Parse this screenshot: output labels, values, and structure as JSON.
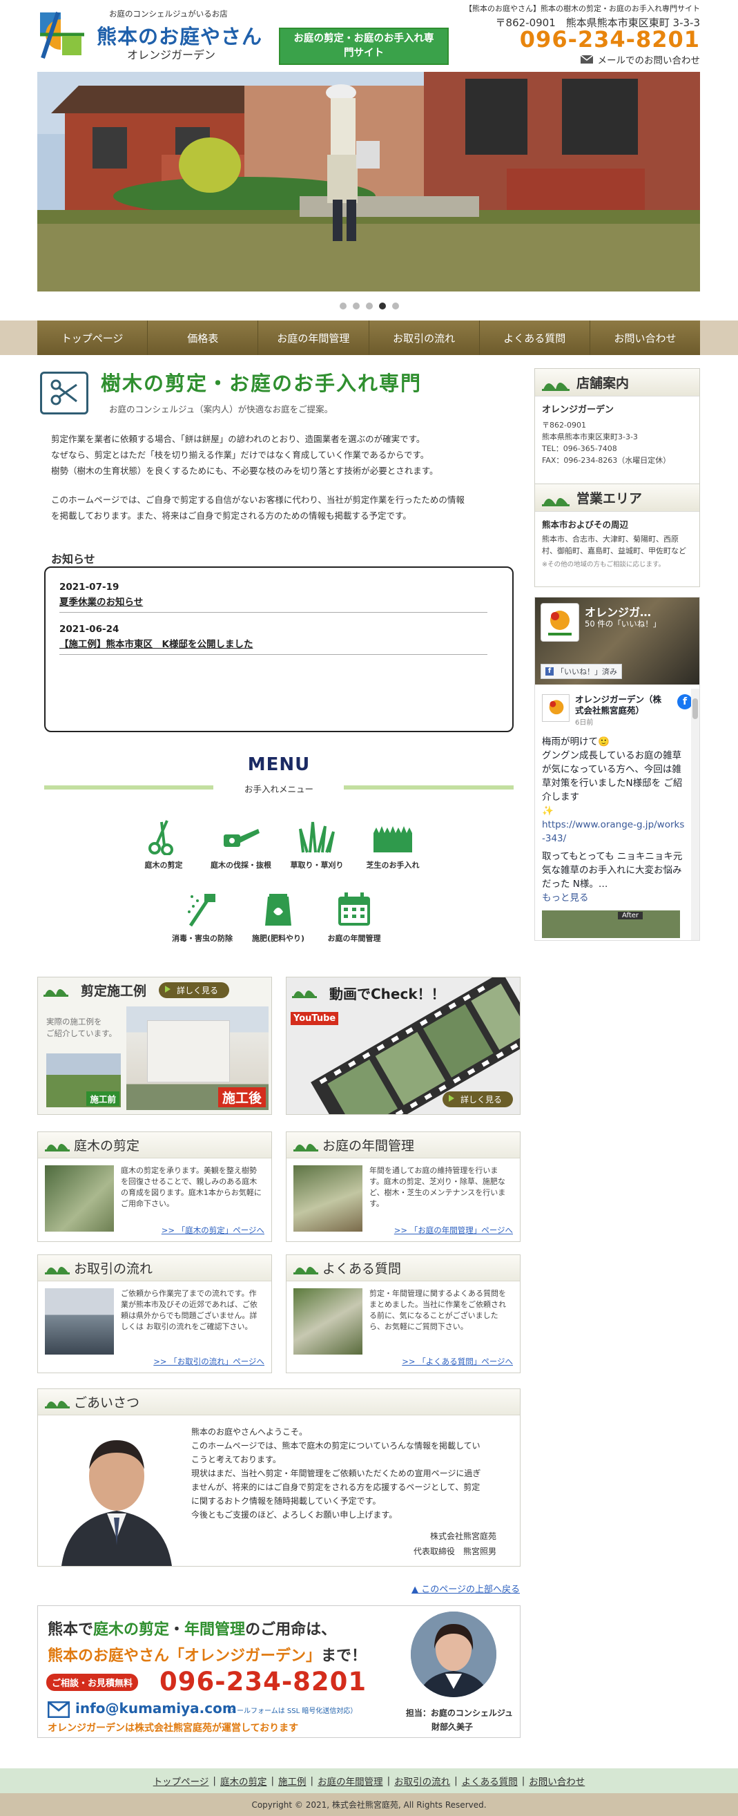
{
  "header": {
    "tagline": "お庭のコンシェルジュがいるお店",
    "logo_name": "熊本のお庭やさん",
    "logo_sub": "オレンジガーデン",
    "badge": "お庭の剪定・お庭のお手入れ専門サイト",
    "top_desc": "【熊本のお庭やさん】熊本の樹木の剪定・お庭のお手入れ専門サイト",
    "address": "〒862-0901　熊本県熊本市東区東町 3-3-3",
    "phone": "096-234-8201",
    "mail_link": "メールでのお問い合わせ"
  },
  "slider": {
    "dots": 5,
    "active_index": 3
  },
  "nav": [
    "トップページ",
    "価格表",
    "お庭の年間管理",
    "お取引の流れ",
    "よくある質問",
    "お問い合わせ"
  ],
  "main": {
    "title": "樹木の剪定・お庭のお手入れ専門",
    "subtitle": "お庭のコンシェルジュ（案内人）が快適なお庭をご提案。",
    "para1": [
      "剪定作業を業者に依頼する場合、「餅は餅屋」の諺われのとおり、造園業者を選ぶのが確実です。",
      "なぜなら、剪定とはただ「枝を切り揃える作業」だけではなく育成していく作業であるからです。",
      "樹勢（樹木の生育状態）を良くするためにも、不必要な枝のみを切り落とす技術が必要とされます。"
    ],
    "para2": [
      "このホームページでは、ご自身で剪定する自信がないお客様に代わり、当社が剪定作業を行ったための情報",
      "を掲載しております。また、将来はご自身で剪定される方のための情報も掲載する予定です。"
    ]
  },
  "news": {
    "heading": "お知らせ",
    "items": [
      {
        "date": "2021-07-19",
        "title": "夏季休業のお知らせ"
      },
      {
        "date": "2021-06-24",
        "title": "【施工例】熊本市東区　K様邸を公開しました"
      }
    ]
  },
  "menu": {
    "heading": "MENU",
    "sub": "お手入れメニュー",
    "items": [
      {
        "label": "庭木の剪定",
        "icon": "pruning-shears-icon"
      },
      {
        "label": "庭木の伐採・抜根",
        "icon": "chainsaw-icon"
      },
      {
        "label": "草取り・草刈り",
        "icon": "grass-icon"
      },
      {
        "label": "芝生のお手入れ",
        "icon": "lawn-icon"
      },
      {
        "label": "消毒・害虫の防除",
        "icon": "sprayer-icon"
      },
      {
        "label": "施肥(肥料やり)",
        "icon": "fertilizer-bag-icon"
      },
      {
        "label": "お庭の年間管理",
        "icon": "calendar-icon"
      }
    ]
  },
  "banners": {
    "sekou": {
      "title": "剪定施工例",
      "btn": "詳しく見る",
      "desc1": "実際の施工例を",
      "desc2": "ご紹介しています。",
      "before": "施工前",
      "after": "施工後"
    },
    "video": {
      "title": "動画でCheck！！",
      "youtube": "YouTube",
      "btn": "詳しく見る"
    }
  },
  "cards": [
    {
      "title": "庭木の剪定",
      "text": "庭木の剪定を承ります。美観を整え樹勢を回復させることで、親しみのある庭木の育成を図ります。庭木1本からお気軽にご用命下さい。",
      "link": ">> 「庭木の剪定」ページへ"
    },
    {
      "title": "お庭の年間管理",
      "text": "年間を通してお庭の維持管理を行います。庭木の剪定、芝刈り・除草、施肥など、樹木・芝生のメンテナンスを行います。",
      "link": ">> 「お庭の年間管理」ページへ"
    },
    {
      "title": "お取引の流れ",
      "text": "ご依頼から作業完了までの流れです。作業が熊本市及びその近郊であれば、ご依頼は県外からでも問題ございません。詳しくは お取引の流れをご確認下さい。",
      "link": ">> 「お取引の流れ」ページへ"
    },
    {
      "title": "よくある質問",
      "text": "剪定・年間管理に関するよくある質問をまとめました。当社に作業をご依頼される前に、気になることがございましたら、お気軽にご質問下さい。",
      "link": ">> 「よくある質問」ページへ"
    }
  ],
  "greeting": {
    "title": "ごあいさつ",
    "lines": [
      "熊本のお庭やさんへようこそ。",
      "このホームページでは、熊本で庭木の剪定についていろんな情報を掲載してい",
      "こうと考えております。",
      "現状はまだ、当社へ剪定・年間管理をご依頼いただくための宣用ページに過ぎ",
      "ませんが、将来的にはご自身で剪定をされる方を応援するページとして、剪定",
      "に関するおトク情報を随時掲載していく予定です。",
      "今後ともご支援のほど、よろしくお願い申し上げます。"
    ],
    "company": "株式会社熊宮庭苑",
    "signer": "代表取締役　熊宮照男"
  },
  "pagetop": "▲ このページの上部へ戻る",
  "cta": {
    "line1a": "熊本で",
    "line1b": "庭木の剪定",
    "line1c": "・",
    "line1d": "年間管理",
    "line1e": "のご用命は、",
    "line2a": "熊本のお庭やさん「オレンジガーデン」",
    "line2b": "まで！",
    "tag": "ご相談・お見積無料",
    "phone": "096-234-8201",
    "email": "info@kumamiya.com",
    "email_note": "（メールフォームは SSL 暗号化送信対応）",
    "note": "オレンジガーデンは株式会社熊宮庭苑が運営しております",
    "staff_role": "担当：お庭のコンシェルジュ",
    "staff_name": "財部久美子"
  },
  "side": {
    "store_title": "店舗案内",
    "store_name": "オレンジガーデン",
    "store_zip": "〒862-0901",
    "store_addr": "熊本県熊本市東区東町3-3-3",
    "store_tel": "TEL：096-365-7408",
    "store_fax": "FAX：096-234-8263（水曜日定休）",
    "area_title": "営業エリア",
    "area_bold": "熊本市およびその周辺",
    "area_list": "熊本市、合志市、大津町、菊陽町、西原村、御船町、嘉島町、益城町、甲佐町など",
    "area_note": "※その他の地域の方もご相談に応じます。",
    "fb_name": "オレンジガ…",
    "fb_likes": "50 件の「いいね！」",
    "fb_like_btn": "「いいね！」済み",
    "fb_post_name": "オレンジガーデン（株式会社熊宮庭苑）",
    "fb_post_time": "6日前",
    "fb_post_lines": [
      "梅雨が明けて🙂",
      "グングン成長しているお庭の雑草が気になっている方へ、今回は雑草対策を行いましたN様邸を ご紹介します",
      "✨"
    ],
    "fb_link": "https://www.orange-g.jp/works-343/",
    "fb_post_more": "取ってもとっても ニョキニョキ元気な雑草のお手入れに大変お悩みだった N様。…",
    "fb_more_label": "もっと見る",
    "fb_after": "After"
  },
  "footer": {
    "links": [
      "トップページ",
      "庭木の剪定",
      "施工例",
      "お庭の年間管理",
      "お取引の流れ",
      "よくある質問",
      "お問い合わせ"
    ],
    "copyright": "Copyright © 2021, 株式会社熊宮庭苑, All Rights Reserved."
  }
}
